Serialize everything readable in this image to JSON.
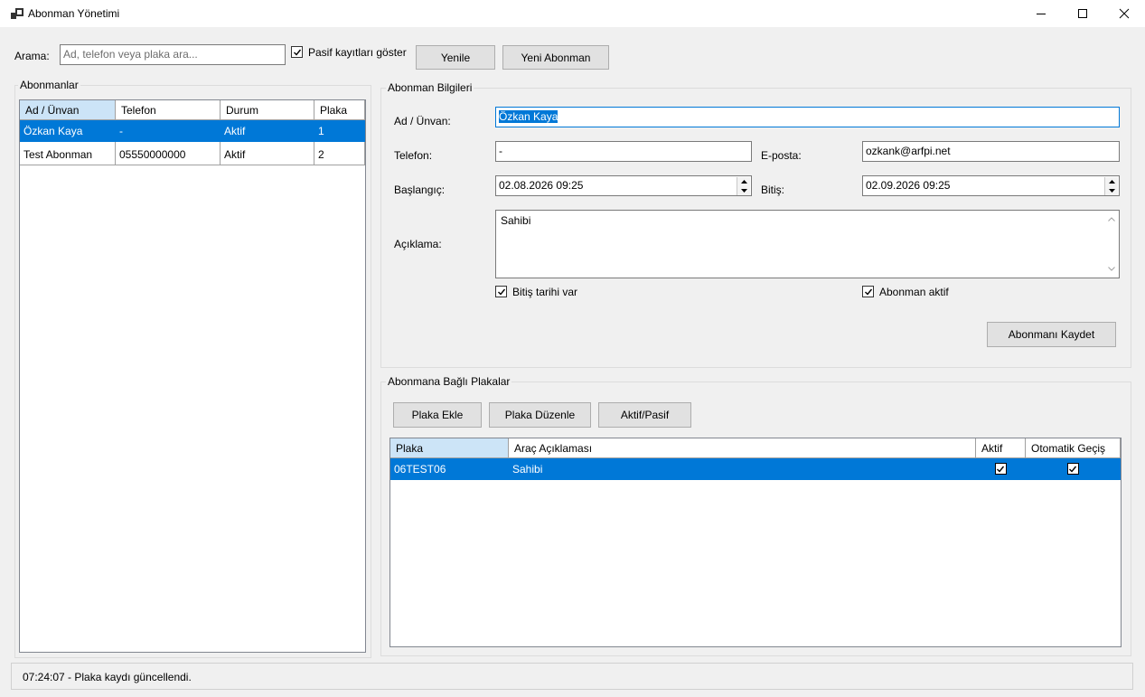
{
  "window": {
    "title": "Abonman Yönetimi",
    "icon": "app-icon",
    "controls": [
      "minimize-icon",
      "maximize-icon",
      "close-icon"
    ]
  },
  "toolbar": {
    "search_label": "Arama:",
    "search_value": "",
    "search_placeholder": "Ad, telefon veya plaka ara...",
    "show_passive_label": "Pasif kayıtları göster",
    "show_passive_checked": true,
    "refresh_label": "Yenile",
    "new_label": "Yeni Abonman"
  },
  "subscribers": {
    "group_title": "Abonmanlar",
    "columns": [
      "Ad / Ünvan",
      "Telefon",
      "Durum",
      "Plaka"
    ],
    "rows": [
      {
        "name": "Özkan Kaya",
        "phone": "-",
        "status": "Aktif",
        "plates": "1",
        "selected": true
      },
      {
        "name": "Test Abonman",
        "phone": "05550000000",
        "status": "Aktif",
        "plates": "2",
        "selected": false
      }
    ]
  },
  "details": {
    "group_title": "Abonman Bilgileri",
    "name_label": "Ad / Ünvan:",
    "name_value": "Özkan Kaya",
    "phone_label": "Telefon:",
    "phone_value": "-",
    "email_label": "E-posta:",
    "email_value": "ozkank@arfpi.net",
    "start_label": "Başlangıç:",
    "start_value": "02.08.2026 09:25",
    "end_label": "Bitiş:",
    "end_value": "02.09.2026 09:25",
    "note_label": "Açıklama:",
    "note_value": "Sahibi",
    "has_end_label": "Bitiş tarihi var",
    "has_end_checked": true,
    "active_label": "Abonman aktif",
    "active_checked": true,
    "save_label": "Abonmanı Kaydet"
  },
  "plates": {
    "group_title": "Abonmana Bağlı Plakalar",
    "add_label": "Plaka Ekle",
    "edit_label": "Plaka Düzenle",
    "toggle_label": "Aktif/Pasif",
    "columns": [
      "Plaka",
      "Araç Açıklaması",
      "Aktif",
      "Otomatik Geçiş"
    ],
    "rows": [
      {
        "plate": "06TEST06",
        "description": "Sahibi",
        "active": true,
        "auto_pass": true,
        "selected": true
      }
    ]
  },
  "status": {
    "text": "07:24:07 - Plaka kaydı güncellendi."
  }
}
